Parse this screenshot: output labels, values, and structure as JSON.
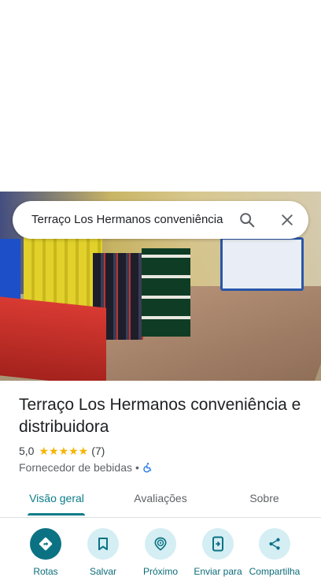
{
  "search": {
    "query": "Terraço Los Hermanos conveniência"
  },
  "place": {
    "title": "Terraço Los Hermanos conveniência e distribuidora",
    "rating": "5,0",
    "stars": "★★★★★",
    "review_count": "(7)",
    "category": "Fornecedor de bebidas",
    "separator": "•"
  },
  "tabs": [
    {
      "label": "Visão geral",
      "active": true
    },
    {
      "label": "Avaliações",
      "active": false
    },
    {
      "label": "Sobre",
      "active": false
    }
  ],
  "actions": [
    {
      "label": "Rotas",
      "icon": "directions-icon"
    },
    {
      "label": "Salvar",
      "icon": "bookmark-icon"
    },
    {
      "label": "Próximo",
      "icon": "nearby-icon"
    },
    {
      "label": "Enviar para",
      "icon": "send-to-phone-icon"
    },
    {
      "label": "Compartilha",
      "icon": "share-icon"
    }
  ],
  "colors": {
    "accent": "#0b7283",
    "accent_light": "#d4eef3",
    "star": "#f6b501"
  }
}
